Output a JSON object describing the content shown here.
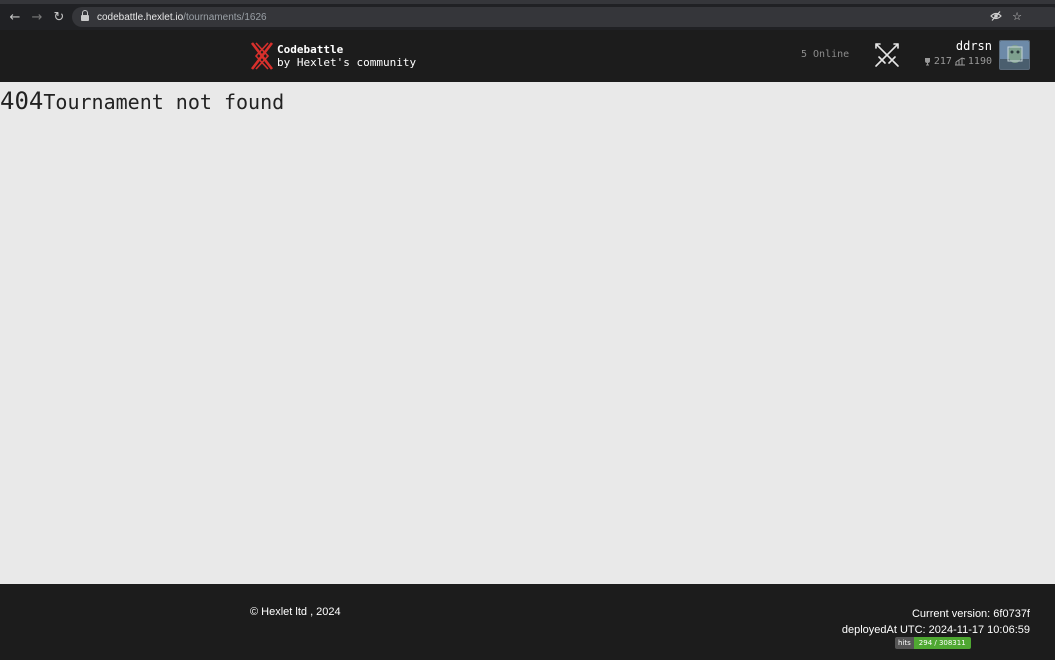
{
  "browser": {
    "url_host": "codebattle.hexlet.io",
    "url_path": "/tournaments/1626",
    "icons": [
      "back-arrow-icon",
      "forward-arrow-icon",
      "reload-icon",
      "lock-icon",
      "eye-off-icon",
      "star-icon"
    ]
  },
  "header": {
    "logo_title": "Codebattle",
    "logo_subtitle": "by Hexlet's community",
    "online_text": "5 Online",
    "username": "ddrsn",
    "rank": "217",
    "rating": "1190"
  },
  "main": {
    "error_code": "404",
    "error_message": "Tournament not found"
  },
  "footer": {
    "copyright": "© Hexlet ltd , 2024",
    "version": "Current version: 6f0737f",
    "deployed": "deployedAt UTC: 2024-11-17 10:06:59",
    "hits_label": "hits",
    "hits_value": "294 / 308311"
  },
  "colors": {
    "header_bg": "#1c1c1c",
    "page_bg": "#e9e9e9",
    "logo_red": "#d8302c",
    "hits_green": "#4fa832"
  }
}
